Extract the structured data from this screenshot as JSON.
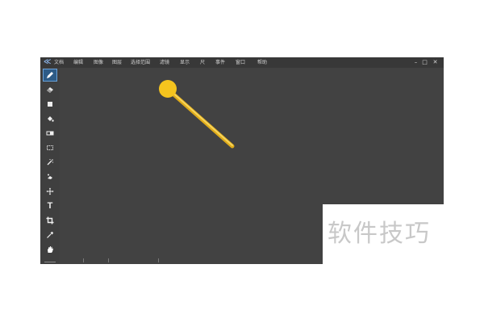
{
  "menu": {
    "items": [
      "文档",
      "编辑",
      "图像",
      "图层",
      "选择范围",
      "滤镜",
      "显示",
      "尺",
      "事件",
      "窗口",
      "帮助"
    ]
  },
  "window_controls": {
    "minimize": "–",
    "maximize": "□",
    "close": "✕"
  },
  "tools": [
    "pencil-icon",
    "eraser-icon",
    "rectangle-fill-icon",
    "paint-bucket-icon",
    "gradient-icon",
    "rect-select-icon",
    "magic-wand-icon",
    "quick-select-icon",
    "move-icon",
    "text-icon",
    "crop-icon",
    "eyedropper-icon",
    "hand-icon"
  ],
  "active_tool": "pencil-icon",
  "text_tool_glyph": "T",
  "watermark": "软件技巧",
  "colors": {
    "window_bg": "#424242",
    "menubar_bg": "#383838",
    "active_tool": "#2d5b86",
    "pointer": "#f5c41e"
  }
}
